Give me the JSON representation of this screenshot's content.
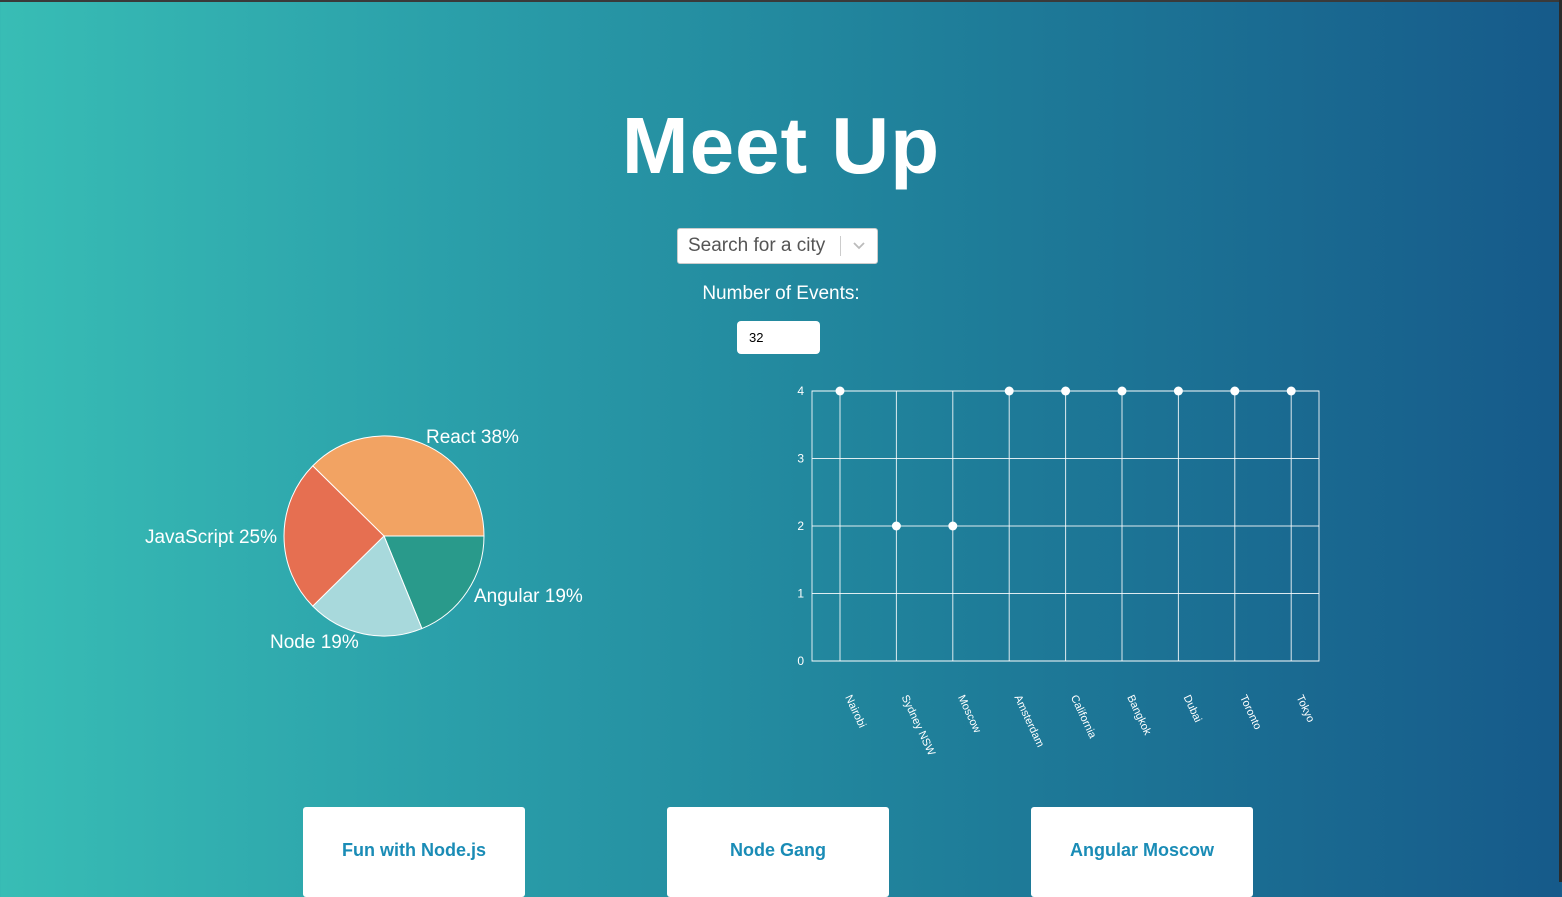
{
  "app": {
    "title": "Meet Up"
  },
  "search": {
    "placeholder": "Search for a city"
  },
  "events": {
    "label": "Number of Events:",
    "value": "32"
  },
  "colors": {
    "react": "#f2a363",
    "javascript": "#e66f51",
    "node": "#a8d9dc",
    "angular": "#299a8b",
    "card_title": "#1a8cb6"
  },
  "chart_data": [
    {
      "type": "pie",
      "slices": [
        {
          "label": "React",
          "value": 38,
          "text": "React 38%"
        },
        {
          "label": "Angular",
          "value": 19,
          "text": "Angular 19%"
        },
        {
          "label": "Node",
          "value": 19,
          "text": "Node 19%"
        },
        {
          "label": "JavaScript",
          "value": 25,
          "text": "JavaScript 25%"
        }
      ]
    },
    {
      "type": "scatter",
      "categories": [
        "Nairobi",
        "Sydney NSW",
        "Moscow",
        "Amsterdam",
        "California",
        "Bangkok",
        "Dubai",
        "Toronto",
        "Tokyo"
      ],
      "values": [
        4,
        2,
        2,
        4,
        4,
        4,
        4,
        4,
        4
      ],
      "yticks": [
        "0",
        "1",
        "2",
        "3",
        "4"
      ],
      "ylim": [
        0,
        4
      ],
      "grid": true
    }
  ],
  "cards": [
    {
      "title": "Fun with Node.js"
    },
    {
      "title": "Node Gang"
    },
    {
      "title": "Angular Moscow"
    }
  ]
}
